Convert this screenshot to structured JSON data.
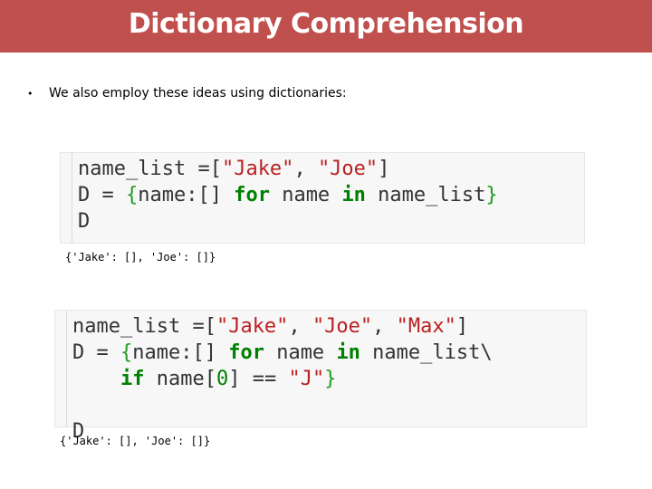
{
  "slide": {
    "title": "Dictionary Comprehension",
    "bullet": "We also employ these ideas using dictionaries:",
    "bullet_marker": "•"
  },
  "cell1": {
    "lines": [
      "name_list =[\"Jake\", \"Joe\"]",
      "D = {name:[] for name in name_list}",
      "D"
    ],
    "output": "{'Jake': [], 'Joe': []}"
  },
  "cell2": {
    "lines": [
      "name_list =[\"Jake\", \"Joe\", \"Max\"]",
      "D = {name:[] for name in name_list\\",
      "    if name[0] == \"J\"}",
      "",
      "D"
    ],
    "output": "{'Jake': [], 'Joe': []}"
  },
  "colors": {
    "title_bar": "#c0504d",
    "keyword": "#008000",
    "string": "#ba2121"
  }
}
